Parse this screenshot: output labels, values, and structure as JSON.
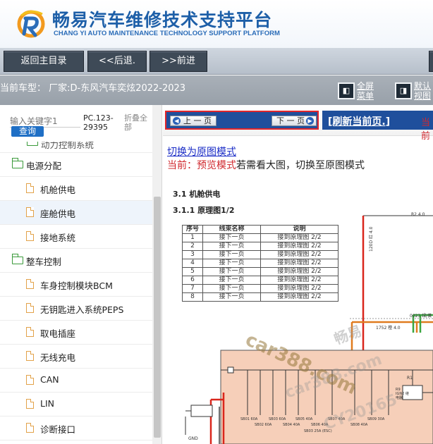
{
  "header": {
    "brand_cn": "畅易汽车维修技术支持平台",
    "brand_en": "CHANG YI AUTO MAINTENANCE TECHNOLOGY SUPPORT PLATFORM",
    "logo_icon": "cy-logo-icon"
  },
  "nav": {
    "home": "返回主目录",
    "back": "<<后退.",
    "forward": ">>前进"
  },
  "info": {
    "car_model": "当前车型： 厂家:D-东风汽车奕炫2022-2023",
    "fullscreen_label": "全屏\n菜单",
    "default_label": "默认\n视图"
  },
  "sidebar": {
    "search_placeholder": "输入关键字1",
    "search_button": "查询",
    "pc_code": "PC.123-29395",
    "collapse_all": "折叠全部",
    "partial_item": "动力控制系统",
    "folders": [
      {
        "label": "电源分配",
        "items": [
          "机舱供电",
          "座舱供电",
          "接地系统"
        ],
        "selected": "座舱供电"
      },
      {
        "label": "整车控制",
        "items": [
          "车身控制模块BCM",
          "无钥匙进入系统PEPS",
          "取电插座",
          "无线充电",
          "CAN",
          "LIN",
          "诊断接口"
        ]
      }
    ]
  },
  "content": {
    "prev_page": "上 一 页",
    "next_page": "下 一 页",
    "refresh": "[刷新当前页.]",
    "refresh_right": "当前",
    "switch_link": "切换为原图模式",
    "mode_current": "当前：预览模式",
    "mode_tip": "若需看大图，切换至原图模式",
    "section_title": "3.1 机舱供电",
    "sub_title": "3.1.1 原理图1/2",
    "table_headers": [
      "序号",
      "线束名称",
      "说明"
    ],
    "table_rows": [
      [
        "1",
        "接下一页",
        "接到原理图 2/2"
      ],
      [
        "2",
        "接下一页",
        "接到原理图 2/2"
      ],
      [
        "3",
        "接下一页",
        "接到原理图 2/2"
      ],
      [
        "4",
        "接下一页",
        "接到原理图 2/2"
      ],
      [
        "5",
        "接下一页",
        "接到原理图 2/2"
      ],
      [
        "6",
        "接下一页",
        "接到原理图 2/2"
      ],
      [
        "7",
        "接下一页",
        "接到原理图 2/2"
      ],
      [
        "8",
        "接下一页",
        "接到原理图 2/2"
      ]
    ],
    "diagram_labels": {
      "r2": "R2 4.0",
      "l1752": "1752 橙 4.0",
      "l0023": "0023 绿/黄",
      "l120d": "120D 红 4.0",
      "gnd": "GND",
      "r1": "R1",
      "fuses": [
        "SB01 60A",
        "SB02 60A",
        "SB03 60A",
        "SB04 40A",
        "SB05 40A",
        "SB06 40A",
        "SB07 40A",
        "SB08 40A",
        "SB09 30A"
      ],
      "esc": "SB03 25A (ESC)",
      "ign": "R9 IGN2 继电器"
    },
    "watermarks": {
      "w1": "car388.com",
      "w2": "畅易",
      "w3": "car388.com",
      "w4": "CY20165"
    }
  },
  "colors": {
    "brand_blue": "#1d5fa8",
    "nav_btn": "#3e4a57",
    "pager_blue": "#1f4f9c",
    "highlight_red": "#e0262b",
    "wire_orange": "#e07b1f",
    "wire_red": "#d9261c",
    "wire_green": "#3aa640",
    "panel_pink": "#f6cfb9"
  }
}
